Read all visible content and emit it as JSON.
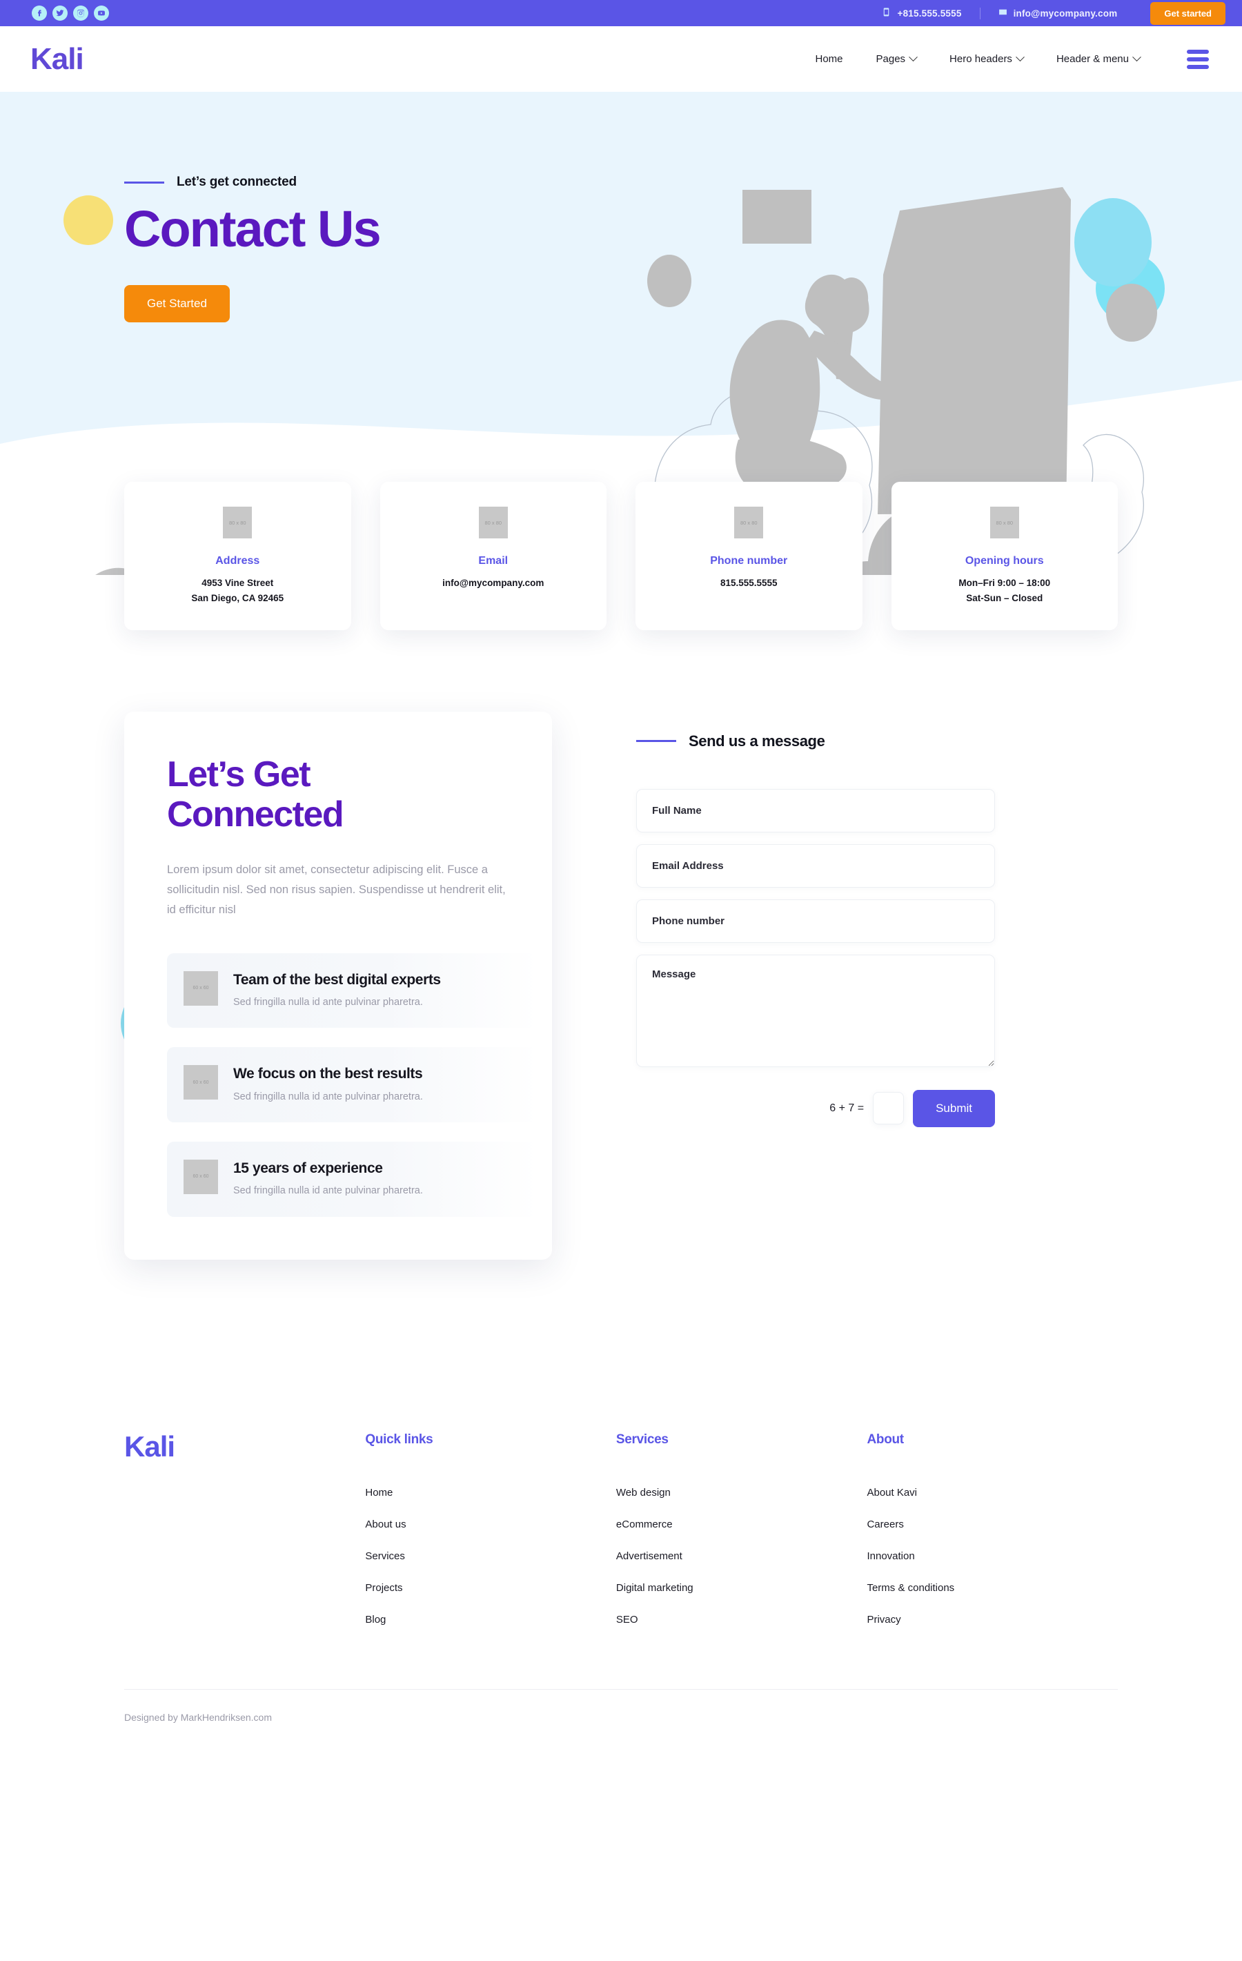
{
  "topbar": {
    "social": [
      {
        "name": "facebook-icon",
        "label": "Facebook"
      },
      {
        "name": "twitter-icon",
        "label": "Twitter"
      },
      {
        "name": "instagram-icon",
        "label": "Instagram"
      },
      {
        "name": "youtube-icon",
        "label": "YouTube"
      }
    ],
    "phone": "+815.555.5555",
    "email": "info@mycompany.com",
    "cta": "Get started",
    "bg_color": "#5a55e6",
    "cta_color": "#f58a0b"
  },
  "nav": {
    "logo": "Kali",
    "items": [
      {
        "label": "Home",
        "has_caret": false
      },
      {
        "label": "Pages",
        "has_caret": true
      },
      {
        "label": "Hero headers",
        "has_caret": true
      },
      {
        "label": "Header & menu",
        "has_caret": true
      }
    ],
    "menu_icon": "hamburger-icon"
  },
  "hero": {
    "eyebrow": "Let’s get connected",
    "title": "Contact Us",
    "cta": "Get Started",
    "bg_color": "#e9f5fd",
    "title_color": "#5a19bf"
  },
  "info_cards": [
    {
      "image_label": "80 x 80",
      "title": "Address",
      "lines": [
        "4953 Vine Street",
        "San Diego, CA 92465"
      ]
    },
    {
      "image_label": "80 x 80",
      "title": "Email",
      "lines": [
        "info@mycompany.com"
      ]
    },
    {
      "image_label": "80 x 80",
      "title": "Phone number",
      "lines": [
        "815.555.5555"
      ]
    },
    {
      "image_label": "80 x 80",
      "title": "Opening hours",
      "lines": [
        "Mon–Fri 9:00 – 18:00",
        "Sat-Sun – Closed"
      ]
    }
  ],
  "connected": {
    "title_line1": "Let’s Get",
    "title_line2": "Connected",
    "paragraph": "Lorem ipsum dolor sit amet, consectetur adipiscing elit. Fusce a sollicitudin nisl. Sed non risus sapien. Suspendisse ut hendrerit elit, id efficitur nisl",
    "features": [
      {
        "image_label": "60 x 60",
        "title": "Team of the best digital experts",
        "desc": "Sed fringilla nulla id ante pulvinar pharetra."
      },
      {
        "image_label": "60 x 60",
        "title": "We focus on the best results",
        "desc": "Sed fringilla nulla id ante pulvinar pharetra."
      },
      {
        "image_label": "60 x 60",
        "title": "15 years of experience",
        "desc": "Sed fringilla nulla id ante pulvinar pharetra."
      }
    ]
  },
  "form": {
    "heading": "Send us a message",
    "fields": [
      {
        "name": "full-name",
        "placeholder": "Full Name",
        "value": ""
      },
      {
        "name": "email-address",
        "placeholder": "Email Address",
        "value": ""
      },
      {
        "name": "phone-number",
        "placeholder": "Phone number",
        "value": ""
      }
    ],
    "message_placeholder": "Message",
    "message_value": "",
    "captcha_question": "6 + 7 =",
    "captcha_value": "",
    "submit_label": "Submit",
    "submit_color": "#5a55e6"
  },
  "footer": {
    "logo": "Kali",
    "columns": [
      {
        "heading": "Quick links",
        "links": [
          "Home",
          "About us",
          "Services",
          "Projects",
          "Blog"
        ]
      },
      {
        "heading": "Services",
        "links": [
          "Web design",
          "eCommerce",
          "Advertisement",
          "Digital marketing",
          "SEO"
        ]
      },
      {
        "heading": "About",
        "links": [
          "About Kavi",
          "Careers",
          "Innovation",
          "Terms & conditions",
          "Privacy"
        ]
      }
    ],
    "credit": "Designed by MarkHendriksen.com"
  }
}
